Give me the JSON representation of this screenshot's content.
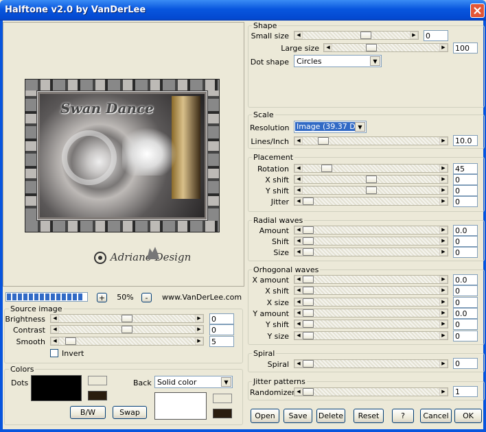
{
  "window": {
    "title": "Halftone v2.0 by VanDerLee"
  },
  "preview": {
    "image_title": "Swan Dance",
    "logo_text": "Adriano Design"
  },
  "zoom": {
    "value": "50%",
    "minus": "-",
    "plus": "+",
    "url": "www.VanDerLee.com",
    "progress_segments": 14
  },
  "source_image": {
    "label": "Source image",
    "brightness": {
      "label": "Brightness",
      "value": "0",
      "pos": 0.5
    },
    "contrast": {
      "label": "Contrast",
      "value": "0",
      "pos": 0.5
    },
    "smooth": {
      "label": "Smooth",
      "value": "5",
      "pos": 0.05
    },
    "invert": {
      "label": "Invert",
      "checked": false
    }
  },
  "colors": {
    "label": "Colors",
    "dots_label": "Dots",
    "back_label": "Back",
    "back_mode": "Solid color",
    "bw_button": "B/W",
    "swap_button": "Swap",
    "dots_color": "#000000",
    "back_color": "#ffffff",
    "dots_swatch_small": "#ece9d8",
    "dots_swatch_dark": "#2a1d0e",
    "back_swatch_small": "#ece9d8",
    "back_swatch_dark": "#2a1d0e"
  },
  "shape": {
    "label": "Shape",
    "small_size": {
      "label": "Small size",
      "value": "0",
      "pos": 0.6
    },
    "large_size": {
      "label": "Large size",
      "value": "100",
      "pos": 0.35
    },
    "dot_shape": {
      "label": "Dot shape",
      "value": "Circles"
    }
  },
  "scale": {
    "label": "Scale",
    "resolution": {
      "label": "Resolution",
      "value": "Image (39.37 DPI"
    },
    "lines_inch": {
      "label": "Lines/Inch",
      "value": "10.0",
      "pos": 0.12
    }
  },
  "placement": {
    "label": "Placement",
    "rotation": {
      "label": "Rotation",
      "value": "45",
      "pos": 0.15
    },
    "x_shift": {
      "label": "X shift",
      "value": "0",
      "pos": 0.5
    },
    "y_shift": {
      "label": "Y shift",
      "value": "0",
      "pos": 0.5
    },
    "jitter": {
      "label": "Jitter",
      "value": "0",
      "pos": 0.0
    }
  },
  "radial_waves": {
    "label": "Radial waves",
    "amount": {
      "label": "Amount",
      "value": "0.0",
      "pos": 0.0
    },
    "shift": {
      "label": "Shift",
      "value": "0",
      "pos": 0.0
    },
    "size": {
      "label": "Size",
      "value": "0",
      "pos": 0.0
    }
  },
  "orhogonal_waves": {
    "label": "Orhogonal waves",
    "x_amount": {
      "label": "X amount",
      "value": "0.0",
      "pos": 0.0
    },
    "x_shift": {
      "label": "X shift",
      "value": "0",
      "pos": 0.0
    },
    "x_size": {
      "label": "X size",
      "value": "0",
      "pos": 0.0
    },
    "y_amount": {
      "label": "Y amount",
      "value": "0.0",
      "pos": 0.0
    },
    "y_shift": {
      "label": "Y shift",
      "value": "0",
      "pos": 0.0
    },
    "y_size": {
      "label": "Y size",
      "value": "0",
      "pos": 0.0
    }
  },
  "spiral": {
    "label": "Spiral",
    "spiral": {
      "label": "Spiral",
      "value": "0",
      "pos": 0.0
    }
  },
  "jitter_patterns": {
    "label": "Jitter patterns",
    "randomizer": {
      "label": "Randomizer",
      "value": "1",
      "pos": 0.0
    }
  },
  "buttons": {
    "open": "Open",
    "save": "Save",
    "delete": "Delete",
    "reset": "Reset",
    "help": "?",
    "cancel": "Cancel",
    "ok": "OK"
  }
}
